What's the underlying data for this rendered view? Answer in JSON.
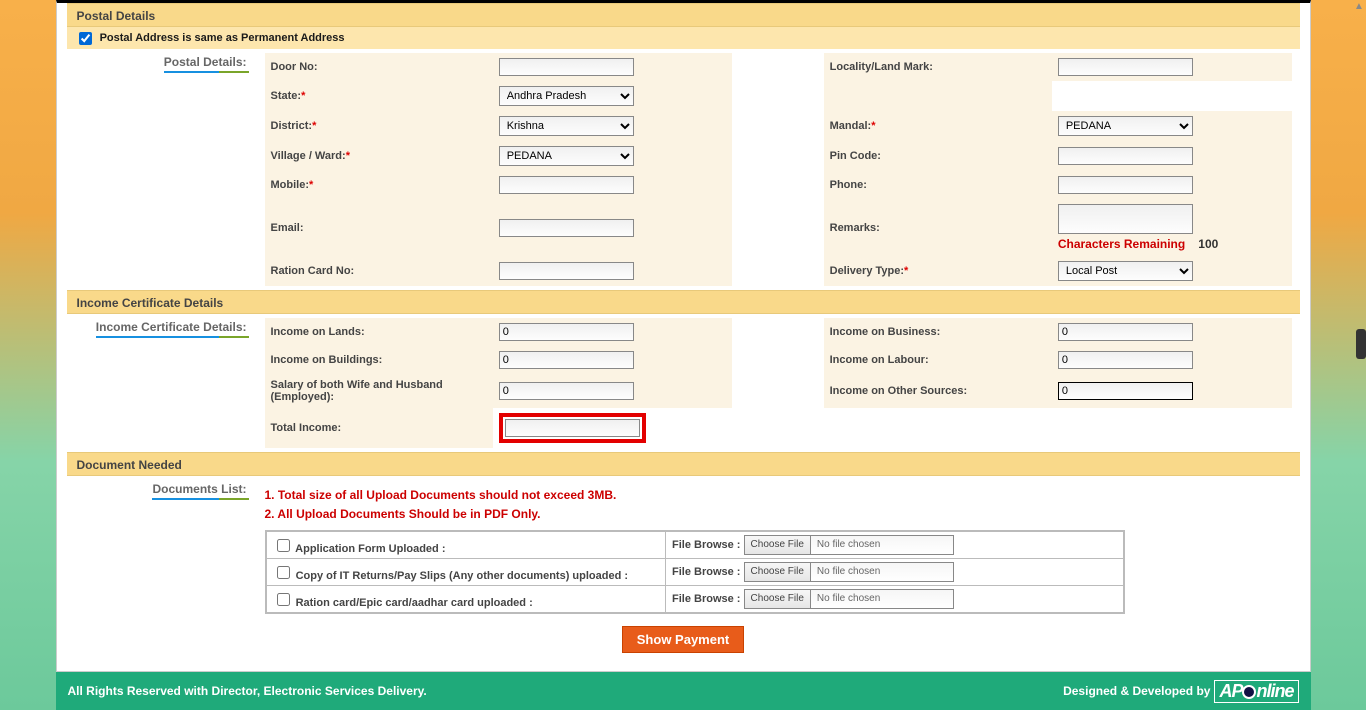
{
  "sections": {
    "postal_header": "Postal Details",
    "postal_same_label": "Postal Address is same as Permanent Address",
    "postal_side": "Postal Details:",
    "income_header": "Income Certificate Details",
    "income_side": "Income Certificate Details:",
    "doc_header": "Document Needed",
    "doc_side": "Documents List:"
  },
  "postal": {
    "door_label": "Door No:",
    "locality_label": "Locality/Land Mark:",
    "state_label": "State:",
    "state_value": "Andhra Pradesh",
    "district_label": "District:",
    "district_value": "Krishna",
    "mandal_label": "Mandal:",
    "mandal_value": "PEDANA",
    "village_label": "Village / Ward:",
    "village_value": "PEDANA",
    "pin_label": "Pin Code:",
    "mobile_label": "Mobile:",
    "phone_label": "Phone:",
    "email_label": "Email:",
    "remarks_label": "Remarks:",
    "chars_remaining_label": "Characters Remaining",
    "chars_remaining_value": "100",
    "ration_label": "Ration Card No:",
    "delivery_label": "Delivery Type:",
    "delivery_value": "Local Post"
  },
  "income": {
    "lands_label": "Income on Lands:",
    "lands_value": "0",
    "business_label": "Income on Business:",
    "business_value": "0",
    "buildings_label": "Income on Buildings:",
    "buildings_value": "0",
    "labour_label": "Income on Labour:",
    "labour_value": "0",
    "salary_label": "Salary of both Wife and Husband (Employed):",
    "salary_value": "0",
    "other_label": "Income on Other Sources:",
    "other_value": "0",
    "total_label": "Total Income:",
    "total_value": ""
  },
  "docs": {
    "note1": "1. Total size of all Upload Documents should not exceed 3MB.",
    "note2": "2. All Upload Documents Should be in PDF Only.",
    "row1": "Application Form Uploaded :",
    "row2": "Copy of IT Returns/Pay Slips (Any other documents) uploaded :",
    "row3": "Ration card/Epic card/aadhar card uploaded :",
    "file_browse_label": "File Browse :",
    "choose_file": "Choose File",
    "no_file": "No file chosen"
  },
  "buttons": {
    "show_payment": "Show Payment"
  },
  "footer": {
    "left": "All Rights Reserved with Director, Electronic Services Delivery.",
    "right": "Designed & Developed by"
  }
}
